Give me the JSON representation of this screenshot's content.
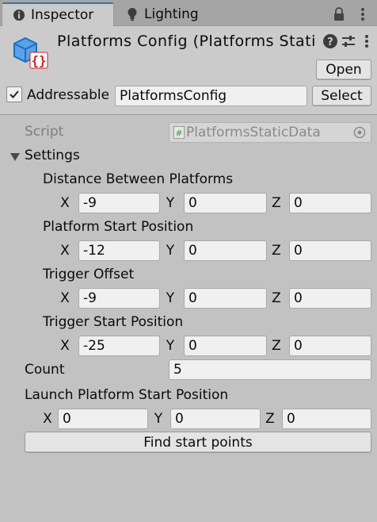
{
  "tabs": [
    {
      "label": "Inspector",
      "icon": "info-icon",
      "active": true
    },
    {
      "label": "Lighting",
      "icon": "bulb-icon",
      "active": false
    }
  ],
  "header": {
    "title": "Platforms Config (Platforms Static",
    "open_label": "Open",
    "addressable_label": "Addressable",
    "addressable_checked": true,
    "address_value": "PlatformsConfig",
    "select_label": "Select"
  },
  "script": {
    "label": "Script",
    "value": "PlatformsStaticData"
  },
  "settings": {
    "label": "Settings",
    "expanded": true,
    "vectors": [
      {
        "label": "Distance Between Platforms",
        "x": "-9",
        "y": "0",
        "z": "0"
      },
      {
        "label": "Platform Start Position",
        "x": "-12",
        "y": "0",
        "z": "0"
      },
      {
        "label": "Trigger Offset",
        "x": "-9",
        "y": "0",
        "z": "0"
      },
      {
        "label": "Trigger Start Position",
        "x": "-25",
        "y": "0",
        "z": "0"
      }
    ]
  },
  "count": {
    "label": "Count",
    "value": "5"
  },
  "launch": {
    "label": "Launch Platform Start Position",
    "x": "0",
    "y": "0",
    "z": "0"
  },
  "axes": {
    "x": "X",
    "y": "Y",
    "z": "Z"
  },
  "find_button_label": "Find start points",
  "colors": {
    "accent": "#3a72b0",
    "background": "#c2c2c2",
    "field": "#f0f0f0"
  }
}
